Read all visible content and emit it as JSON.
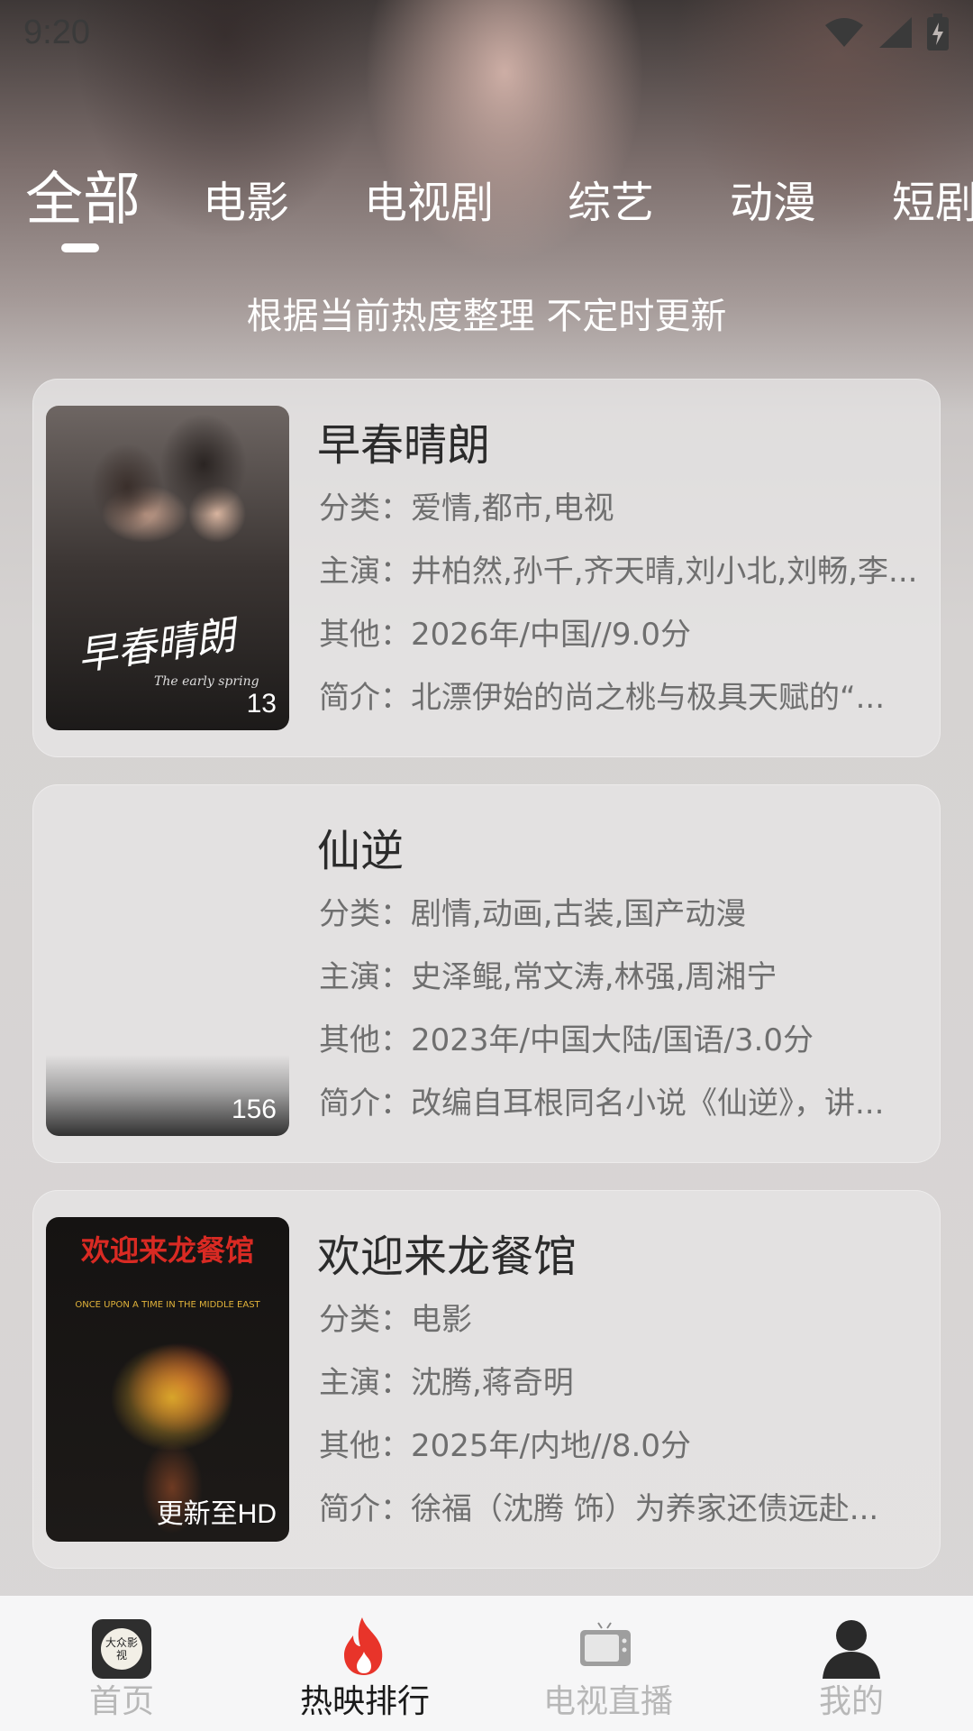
{
  "status_bar": {
    "time": "9:20"
  },
  "tabs": [
    "全部",
    "电影",
    "电视剧",
    "综艺",
    "动漫",
    "短剧"
  ],
  "active_tab": "全部",
  "subtitle": "根据当前热度整理 不定时更新",
  "cards": [
    {
      "title": "早春晴朗",
      "badge": "13",
      "poster_text": "早春晴朗",
      "poster_subtext": "The early spring",
      "category": "分类：爱情,都市,电视",
      "cast": "主演：井柏然,孙千,齐天晴,刘小北,刘畅,李...",
      "other": "其他：2026年/中国//9.0分",
      "intro": "简介：北漂伊始的尚之桃与极具天赋的“..."
    },
    {
      "title": "仙逆",
      "badge": "156",
      "category": "分类：剧情,动画,古装,国产动漫",
      "cast": "主演：史泽鲲,常文涛,林强,周湘宁",
      "other": "其他：2023年/中国大陆/国语/3.0分",
      "intro": "简介：改编自耳根同名小说《仙逆》，讲..."
    },
    {
      "title": "欢迎来龙餐馆",
      "badge": "更新至HD",
      "poster_text": "欢迎来龙餐馆",
      "poster_subtext": "ONCE UPON A TIME IN THE MIDDLE EAST",
      "category": "分类：电影",
      "cast": "主演：沈腾,蒋奇明",
      "other": "其他：2025年/内地//8.0分",
      "intro": "简介：徐福（沈腾 饰）为养家还债远赴..."
    }
  ],
  "bottom_nav": {
    "items": [
      "首页",
      "热映排行",
      "电视直播",
      "我的"
    ],
    "active": "热映排行",
    "logo_text": "大众影视"
  },
  "colors": {
    "accent": "#e8342a",
    "text_dark": "#2b2b2b",
    "text_gray": "#6f6f6f"
  }
}
